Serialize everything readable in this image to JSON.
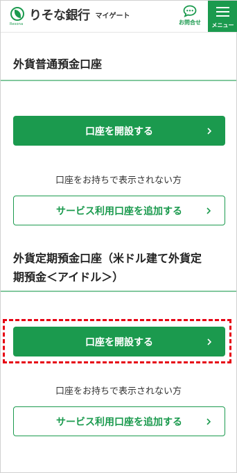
{
  "header": {
    "bank_name": "りそな銀行",
    "service_name": "マイゲート",
    "logo_sub": "Resona",
    "contact_label": "お問合せ",
    "menu_label": "メニュー"
  },
  "sections": [
    {
      "title": "外貨普通預金口座",
      "open_button": "口座を開設する",
      "note": "口座をお持ちで表示されない方",
      "add_button": "サービス利用口座を追加する"
    },
    {
      "title_line1": "外貨定期預金口座（米ドル建て外貨定",
      "title_line2": "期預金＜アイドル＞）",
      "open_button": "口座を開設する",
      "note": "口座をお持ちで表示されない方",
      "add_button": "サービス利用口座を追加する"
    }
  ],
  "colors": {
    "brand_green": "#1b9a4e",
    "highlight_red": "#e60012"
  }
}
